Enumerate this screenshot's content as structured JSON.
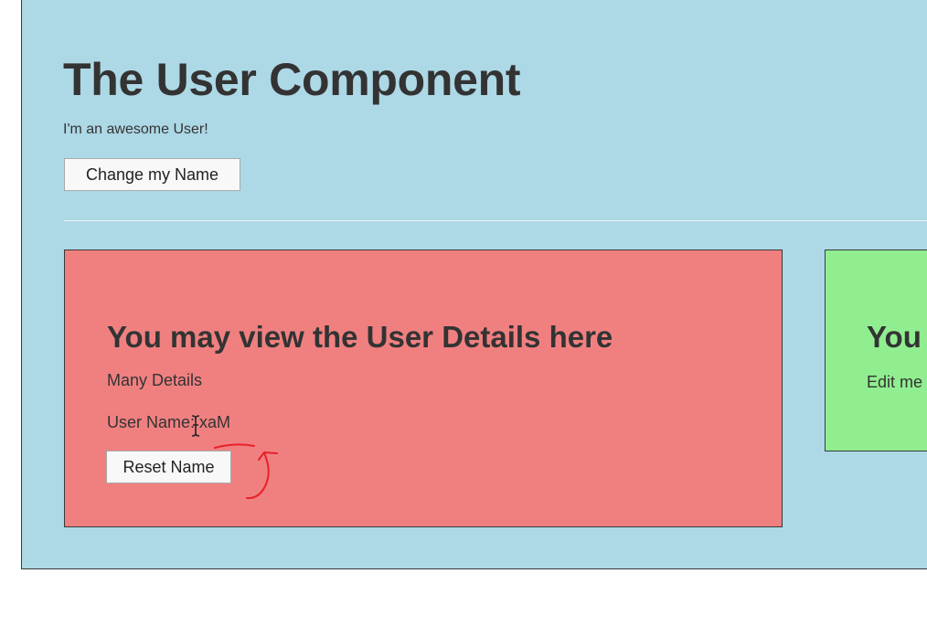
{
  "header": {
    "title": "The User Component",
    "subtitle": "I'm an awesome User!",
    "change_name_label": "Change my Name"
  },
  "user_detail": {
    "title": "You may view the User Details here",
    "details": "Many Details",
    "user_name_line": "User Name: xaM",
    "reset_label": "Reset Name"
  },
  "user_edit": {
    "title": "You",
    "text": "Edit me"
  },
  "colors": {
    "page_background": "#add8e6",
    "detail_card": "#f08080",
    "edit_card": "#90ee90",
    "annotation_pen": "#e8202a"
  },
  "icons": {
    "cursor": "text-cursor-icon",
    "annotation": "red-underline-and-curved-arrow"
  }
}
